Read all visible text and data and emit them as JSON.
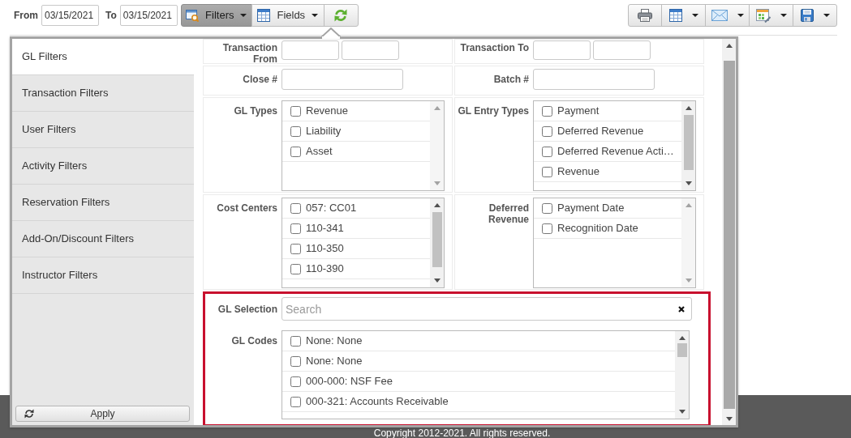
{
  "toolbar": {
    "from_label": "From",
    "from_date": "03/15/2021",
    "to_label": "To",
    "to_date": "03/15/2021",
    "view_buttons": [
      {
        "label": "Filters",
        "kind": "dropdown",
        "active": true
      },
      {
        "label": "Fields",
        "kind": "dropdown",
        "active": false
      },
      {
        "kind": "button",
        "active": false
      }
    ],
    "output_buttons": [
      {
        "kind": "button",
        "active": false
      },
      {
        "kind": "dropdown",
        "active": false
      },
      {
        "kind": "dropdown",
        "active": false
      },
      {
        "kind": "dropdown",
        "active": false
      },
      {
        "kind": "dropdown",
        "active": false
      }
    ]
  },
  "filter_popover": {
    "sidebar": {
      "items": [
        {
          "label": "GL Filters",
          "selected": true
        },
        {
          "label": "Transaction Filters",
          "selected": false
        },
        {
          "label": "User Filters",
          "selected": false
        },
        {
          "label": "Activity Filters",
          "selected": false
        },
        {
          "label": "Reservation Filters",
          "selected": false
        },
        {
          "label": "Add-On/Discount Filters",
          "selected": false
        },
        {
          "label": "Instructor Filters",
          "selected": false
        }
      ],
      "apply_button": "Apply"
    },
    "rows": [
      {
        "fields": [
          {
            "label": "Transaction From",
            "kind": "range"
          },
          {
            "label": "Transaction To",
            "kind": "range"
          }
        ]
      },
      {
        "fields": [
          {
            "label": "Close #",
            "kind": "text"
          },
          {
            "label": "Batch #",
            "kind": "text"
          }
        ]
      },
      {
        "fields": [
          {
            "label": "GL Types",
            "kind": "checklist",
            "scrollable": false,
            "items": [
              {
                "label": "Revenue",
                "checked": false
              },
              {
                "label": "Liability",
                "checked": false
              },
              {
                "label": "Asset",
                "checked": false
              }
            ]
          },
          {
            "label": "GL Entry Types",
            "kind": "checklist",
            "scrollable": true,
            "items": [
              {
                "label": "Payment",
                "checked": false
              },
              {
                "label": "Deferred Revenue",
                "checked": false
              },
              {
                "label": "Deferred Revenue Acti…",
                "checked": false
              },
              {
                "label": "Revenue",
                "checked": false
              }
            ]
          }
        ]
      },
      {
        "fields": [
          {
            "label": "Cost Centers",
            "kind": "checklist",
            "scrollable": true,
            "items": [
              {
                "label": "057: CC01",
                "checked": false
              },
              {
                "label": "110-341",
                "checked": false
              },
              {
                "label": "110-350",
                "checked": false
              },
              {
                "label": "110-390",
                "checked": false
              }
            ]
          },
          {
            "label": "Deferred Revenue",
            "kind": "checklist",
            "scrollable": false,
            "items": [
              {
                "label": "Payment Date",
                "checked": false
              },
              {
                "label": "Recognition Date",
                "checked": false
              }
            ]
          }
        ]
      }
    ],
    "highlighted_section": {
      "highlighted": true,
      "fields": [
        {
          "label": "GL Selection",
          "kind": "search",
          "placeholder": "Search"
        },
        {
          "label": "GL Codes",
          "kind": "checklist",
          "scrollable": true,
          "items": [
            {
              "label": "None: None",
              "checked": false
            },
            {
              "label": "None: None",
              "checked": false
            },
            {
              "label": "000-000: NSF Fee",
              "checked": false
            },
            {
              "label": "000-321: Accounts Receivable",
              "checked": false
            }
          ]
        }
      ]
    }
  },
  "footer": {
    "copyright": "Copyright 2012-2021. All rights reserved."
  }
}
